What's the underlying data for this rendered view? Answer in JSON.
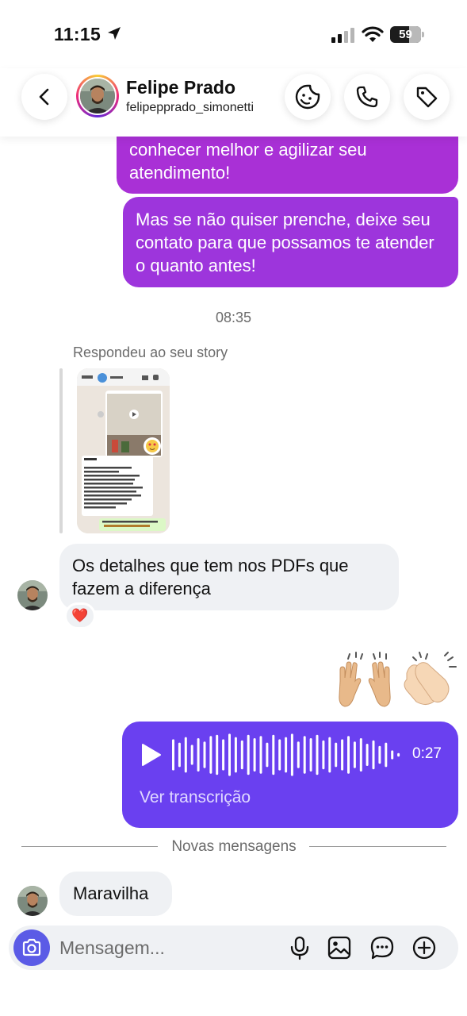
{
  "status_bar": {
    "time": "11:15",
    "battery": "59"
  },
  "header": {
    "name": "Felipe Prado",
    "username": "felipepprado_simonetti"
  },
  "messages": {
    "sent_1": "conhecer melhor e agilizar seu atendimento!",
    "sent_2": "Mas se não quiser prenche, deixe seu contato para que possamos te atender o quanto antes!",
    "timestamp": "08:35",
    "story_reply_label": "Respondeu ao seu story",
    "received_1": "Os detalhes que tem nos PDFs que fazem a diferença",
    "reaction": "❤️",
    "sent_emojis": "🙌🏼👏🏻",
    "voice": {
      "duration": "0:27",
      "transcription_link": "Ver transcrição"
    },
    "new_messages_divider": "Novas mensagens",
    "received_2": "Maravilha"
  },
  "composer": {
    "placeholder": "Mensagem..."
  },
  "colors": {
    "sent_bubble": "#9d35dc",
    "voice_bubble": "#6a40f0",
    "received_bubble": "#eff1f4",
    "camera_button": "#5b5be6"
  },
  "icons": [
    "back-icon",
    "sticker-icon",
    "phone-icon",
    "tag-icon",
    "play-icon",
    "camera-icon",
    "mic-icon",
    "gallery-icon",
    "sticker-chat-icon",
    "plus-icon"
  ]
}
